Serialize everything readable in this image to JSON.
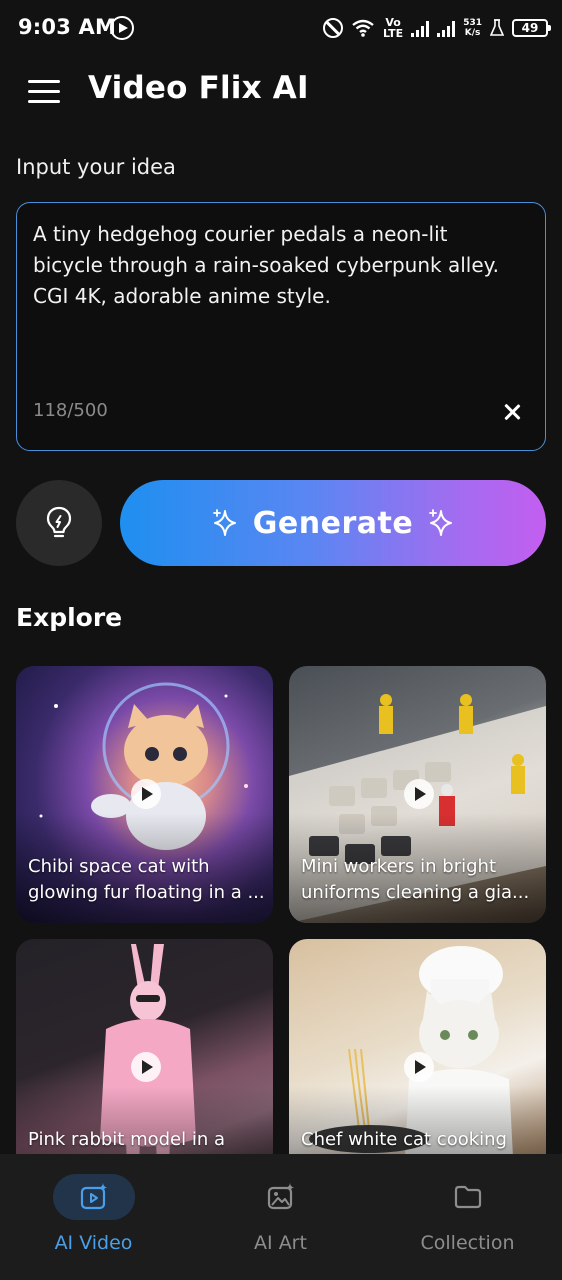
{
  "status_bar": {
    "time": "9:03 AM",
    "volte": "Vo\nLTE",
    "speed_value": "531",
    "speed_unit": "K/s",
    "battery": "49"
  },
  "header": {
    "title": "Video Flix AI"
  },
  "prompt": {
    "label": "Input your idea",
    "value": "A tiny hedgehog courier pedals a neon-lit bicycle through a rain-soaked cyberpunk alley. CGI 4K, adorable anime style.",
    "char_count": "118/500"
  },
  "actions": {
    "generate_label": "Generate"
  },
  "explore": {
    "title": "Explore",
    "cards": [
      {
        "line1": "Chibi space cat with",
        "line2": "glowing fur floating in a ..."
      },
      {
        "line1": "Mini workers in bright",
        "line2": "uniforms cleaning a gia..."
      },
      {
        "line1": "Pink rabbit model in a",
        "line2": ""
      },
      {
        "line1": "Chef white cat cooking",
        "line2": ""
      }
    ]
  },
  "bottom_nav": [
    {
      "label": "AI Video",
      "icon": "ai-video-icon",
      "active": true
    },
    {
      "label": "AI Art",
      "icon": "ai-art-icon",
      "active": false
    },
    {
      "label": "Collection",
      "icon": "folder-icon",
      "active": false
    }
  ],
  "colors": {
    "accent": "#4b9fe8",
    "input_border": "#4a8fd8",
    "generate_gradient_start": "#1e8ff0",
    "generate_gradient_end": "#c35ef0",
    "background": "#121212"
  }
}
